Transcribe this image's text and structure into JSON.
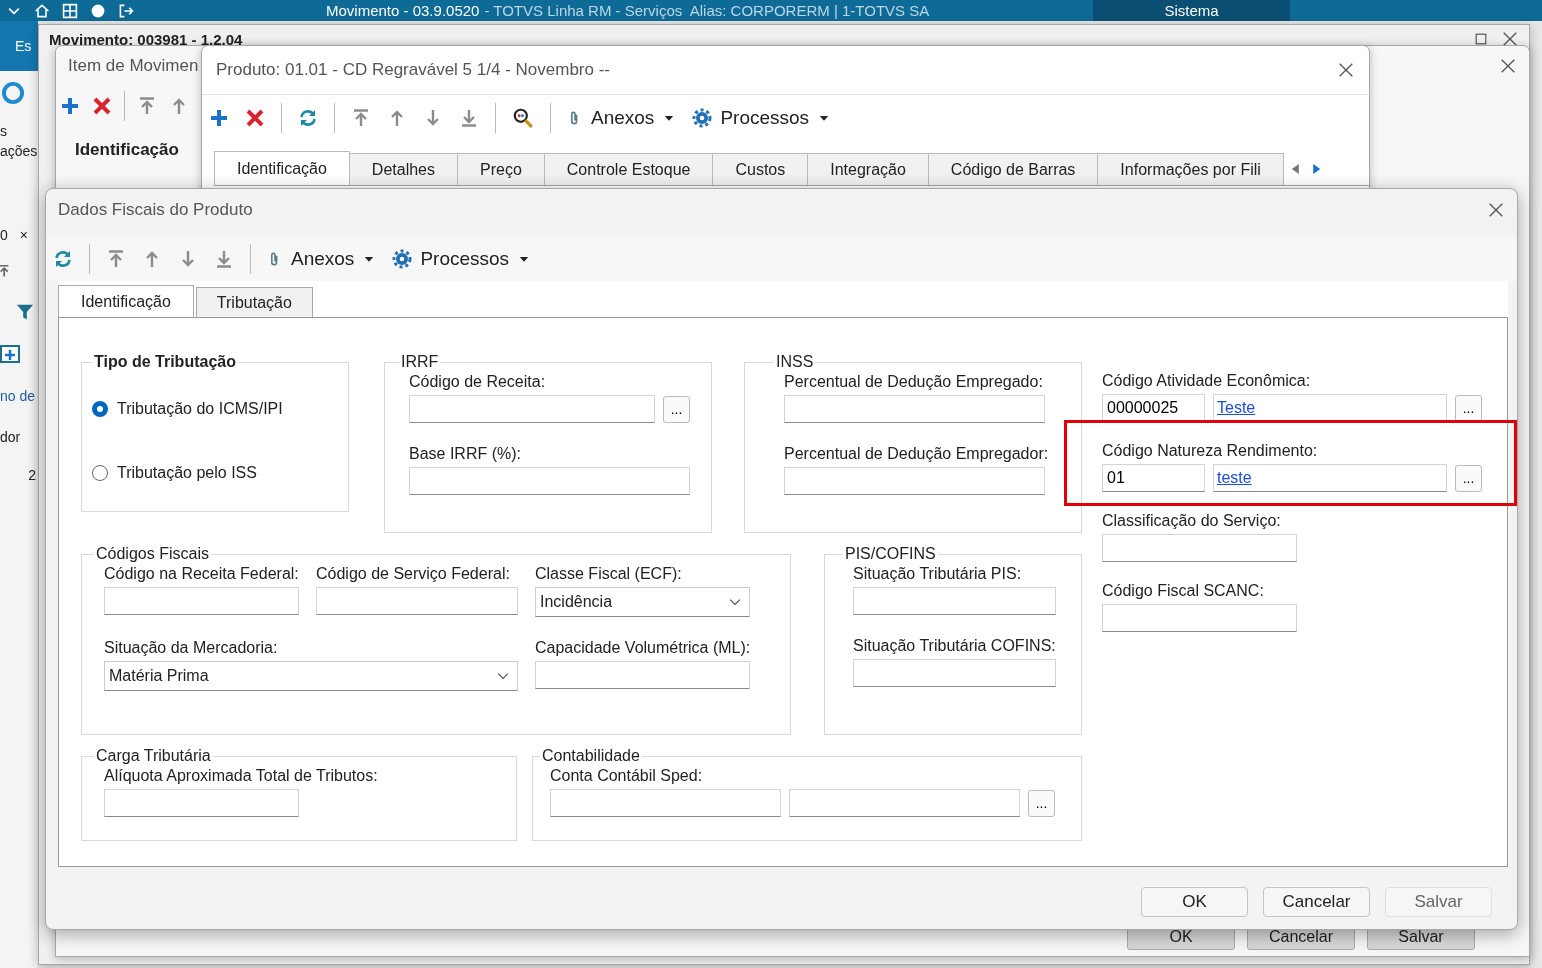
{
  "app_bar": {
    "title": "Movimento - 03.9.0520",
    "subtitle": "- TOTVS Linha RM - Serviços  Alias: CORPORERM | 1-TOTVS SA",
    "section": "Sistema"
  },
  "background": {
    "ribbon_text": "Es",
    "ribbon_label_1": "s",
    "ribbon_label_2": "ações",
    "tab": "0",
    "tab_close": "×",
    "link": "no de",
    "column": "dor",
    "cell": "2"
  },
  "movimento_window": {
    "title": "Movimento: 003981 - 1.2.04"
  },
  "item_window": {
    "title": "Item de Movimen",
    "section": "Identificação",
    "buttons": [
      "OK",
      "Cancelar",
      "Salvar"
    ]
  },
  "produto_window": {
    "title": "Produto: 01.01 - CD Regravável 5 1/4 - Novembro --",
    "menus": [
      "Anexos",
      "Processos"
    ],
    "tabs": [
      {
        "label": "Identificação",
        "selected": true
      },
      {
        "label": "Detalhes",
        "selected": false
      },
      {
        "label": "Preço",
        "selected": false
      },
      {
        "label": "Controle Estoque",
        "selected": false
      },
      {
        "label": "Custos",
        "selected": false
      },
      {
        "label": "Integração",
        "selected": false
      },
      {
        "label": "Código de Barras",
        "selected": false
      },
      {
        "label": "Informações por Fili",
        "selected": false
      }
    ]
  },
  "dialog": {
    "title": "Dados Fiscais do Produto",
    "menus": [
      "Anexos",
      "Processos"
    ],
    "tabs": [
      {
        "label": "Identificação",
        "selected": true
      },
      {
        "label": "Tributação",
        "selected": false
      }
    ],
    "groups": [
      {
        "kind": "radio",
        "title": "Tipo de Tributação",
        "options": [
          {
            "label": "Tributação do ICMS/IPI",
            "selected": true
          },
          {
            "label": "Tributação pelo ISS",
            "selected": false
          }
        ]
      },
      {
        "kind": "fields",
        "title": "IRRF",
        "fields": [
          {
            "kind": "lookup",
            "label": "Código de Receita:",
            "button_label": "..."
          },
          {
            "kind": "text",
            "label": "Base IRRF (%):"
          }
        ]
      },
      {
        "kind": "fields",
        "title": "INSS",
        "fields": [
          {
            "kind": "text",
            "label": "Percentual de Dedução Empregado:"
          },
          {
            "kind": "text",
            "label": "Percentual de Dedução Empregador:"
          }
        ]
      },
      {
        "kind": "fields",
        "title": "Códigos Fiscais",
        "fields": [
          {
            "kind": "text",
            "label": "Código na Receita Federal:"
          },
          {
            "kind": "text",
            "label": "Código de Serviço Federal:"
          },
          {
            "kind": "select",
            "label": "Classe Fiscal (ECF):",
            "value": "Incidência"
          },
          {
            "kind": "select",
            "label": "Situação da Mercadoria:",
            "value": "Matéria Prima"
          },
          {
            "kind": "text",
            "label": "Capacidade Volumétrica (ML):"
          }
        ]
      },
      {
        "kind": "fields",
        "title": "PIS/COFINS",
        "fields": [
          {
            "kind": "text",
            "label": "Situação Tributária PIS:"
          },
          {
            "kind": "text",
            "label": "Situação Tributária COFINS:"
          }
        ]
      },
      {
        "kind": "fields",
        "title": "Carga Tributária",
        "fields": [
          {
            "kind": "text",
            "label": "Alíquota Aproximada Total de Tributos:"
          }
        ]
      },
      {
        "kind": "fields",
        "title": "Contabilidade",
        "fields": [
          {
            "kind": "double-lookup",
            "label": "Conta Contábil Sped:",
            "button_label": "..."
          }
        ]
      }
    ],
    "side_fields": [
      {
        "kind": "link-lookup",
        "label": "Código Atividade Econômica:",
        "code": "00000025",
        "link": "Teste",
        "button_label": "..."
      },
      {
        "kind": "link-lookup",
        "label": "Código Natureza Rendimento:",
        "code": "01",
        "link": "teste",
        "button_label": "...",
        "highlighted": true
      },
      {
        "kind": "text",
        "label": "Classificação do Serviço:"
      },
      {
        "kind": "text",
        "label": "Código Fiscal SCANC:"
      }
    ],
    "buttons": [
      {
        "label": "OK",
        "disabled": false
      },
      {
        "label": "Cancelar",
        "disabled": false
      },
      {
        "label": "Salvar",
        "disabled": true
      }
    ]
  }
}
